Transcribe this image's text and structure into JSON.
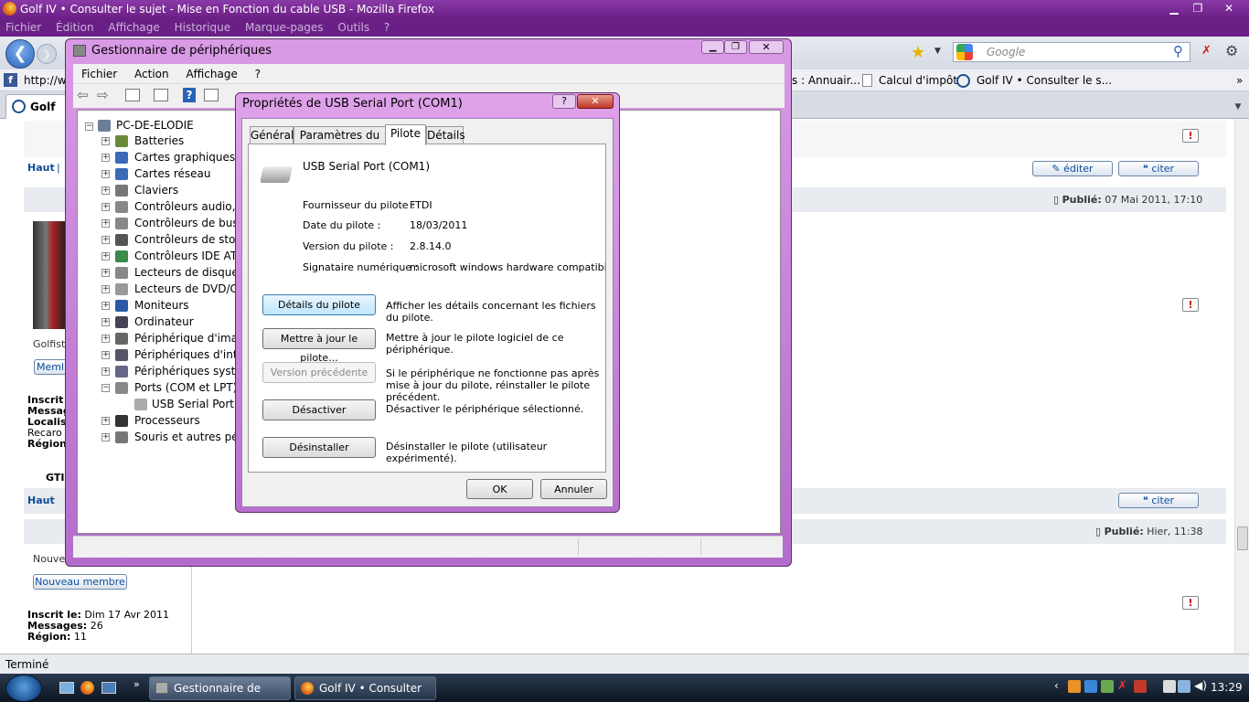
{
  "firefox": {
    "title": "Golf IV • Consulter le sujet - Mise en Fonction du cable USB - Mozilla Firefox",
    "menu": [
      "Fichier",
      "Édition",
      "Affichage",
      "Historique",
      "Marque-pages",
      "Outils",
      "?"
    ],
    "search_placeholder": "Google",
    "bookmarks": {
      "url_prefix": "http://w",
      "b1": "s : Annuair...",
      "b2": "Calcul d'impôt",
      "b3": "Golf IV • Consulter le s..."
    },
    "tab_label": "Golf IV",
    "status": "Terminé"
  },
  "forum": {
    "haut": "Haut",
    "editer": "éditer",
    "citer": "citer",
    "post2_date_label": "Publié:",
    "post2_date": "07 Mai 2011, 17:10",
    "post3_date_label": "Publié:",
    "post3_date": "Hier, 11:38",
    "post2_user_frag": "Golfist",
    "post2_member_btn": "Meml",
    "post2_info_labels": [
      "Inscrit",
      "Messag",
      "Localis",
      "Recaro",
      "Région:"
    ],
    "post2_gti": "GTI",
    "post3_user_frag": "Nouve",
    "post3_member_btn": "Nouveau membre",
    "post3_inscrit_label": "Inscrit le:",
    "post3_inscrit": "Dim 17 Avr 2011",
    "post3_messages_label": "Messages:",
    "post3_messages": "26",
    "post3_region_label": "Région:",
    "post3_region": "11"
  },
  "device_manager": {
    "title": "Gestionnaire de périphériques",
    "menu": [
      "Fichier",
      "Action",
      "Affichage",
      "?"
    ],
    "root": "PC-DE-ELODIE",
    "items": [
      "Batteries",
      "Cartes graphiques",
      "Cartes réseau",
      "Claviers",
      "Contrôleurs audio, vi",
      "Contrôleurs de bus U",
      "Contrôleurs de stock",
      "Contrôleurs IDE ATA/",
      "Lecteurs de disque",
      "Lecteurs de DVD/CD-",
      "Moniteurs",
      "Ordinateur",
      "Périphérique d'image",
      "Périphériques d'inter",
      "Périphériques systèm",
      "Ports (COM et LPT)"
    ],
    "child": "USB Serial Port (C",
    "items_after": [
      "Processeurs",
      "Souris et autres périp"
    ]
  },
  "dialog": {
    "title": "Propriétés de USB Serial Port (COM1)",
    "tabs": [
      "Général",
      "Paramètres du port",
      "Pilote",
      "Détails"
    ],
    "device_name": "USB Serial Port (COM1)",
    "fields": [
      {
        "label": "Fournisseur du pilote :",
        "value": "FTDI"
      },
      {
        "label": "Date du pilote :",
        "value": "18/03/2011"
      },
      {
        "label": "Version du pilote :",
        "value": "2.8.14.0"
      },
      {
        "label": "Signataire numérique :",
        "value": "microsoft windows hardware compatibility pub"
      }
    ],
    "buttons": [
      {
        "label": "Détails du pilote",
        "desc": "Afficher les détails concernant les fichiers du pilote."
      },
      {
        "label": "Mettre à jour le pilote...",
        "desc": "Mettre à jour le pilote logiciel de ce périphérique."
      },
      {
        "label": "Version précédente",
        "desc": "Si le périphérique ne fonctionne pas après mise à jour du pilote, réinstaller le pilote précédent."
      },
      {
        "label": "Désactiver",
        "desc": "Désactiver le périphérique sélectionné."
      },
      {
        "label": "Désinstaller",
        "desc": "Désinstaller le pilote (utilisateur expérimenté)."
      }
    ],
    "ok": "OK",
    "cancel": "Annuler"
  },
  "taskbar": {
    "task1": "Gestionnaire de péri...",
    "task2": "Golf IV • Consulter l...",
    "clock": "13:29"
  }
}
